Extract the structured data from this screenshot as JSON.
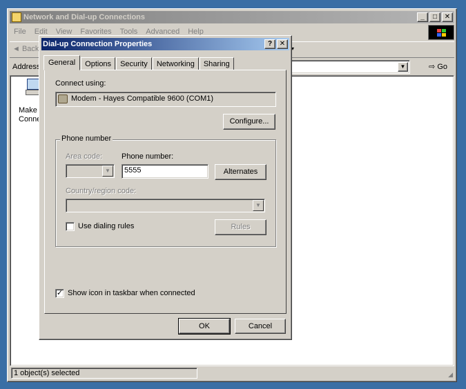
{
  "main_window": {
    "title": "Network and Dial-up Connections",
    "menu": [
      "File",
      "Edit",
      "View",
      "Favorites",
      "Tools",
      "Advanced",
      "Help"
    ],
    "toolbar": {
      "back_label": "Back"
    },
    "address_label": "Address",
    "go_label": "Go",
    "item_label_line1": "Make I",
    "item_label_line2": "Conne",
    "status_text": "1 object(s) selected"
  },
  "dialog": {
    "title": "Dial-up Connection Properties",
    "help_glyph": "?",
    "close_glyph": "✕",
    "tabs": [
      "General",
      "Options",
      "Security",
      "Networking",
      "Sharing"
    ],
    "connect_using_label": "Connect using:",
    "device": "Modem  - Hayes Compatible 9600 (COM1)",
    "configure_label": "Configure...",
    "phone_group_label": "Phone number",
    "area_code_label": "Area code:",
    "phone_number_label": "Phone number:",
    "phone_number_value": "5555",
    "alternates_label": "Alternates",
    "country_label": "Country/region code:",
    "use_dialing_rules_label": "Use dialing rules",
    "use_dialing_rules_checked": false,
    "rules_label": "Rules",
    "show_icon_label": "Show icon in taskbar when connected",
    "show_icon_checked": true,
    "ok_label": "OK",
    "cancel_label": "Cancel"
  },
  "icons": [
    "folder-network-icon",
    "modem-icon",
    "make-connection-icon",
    "back-arrow-icon",
    "go-arrow-icon",
    "windows-logo-icon",
    "dropdown-arrow-icon",
    "checkmark-icon"
  ]
}
